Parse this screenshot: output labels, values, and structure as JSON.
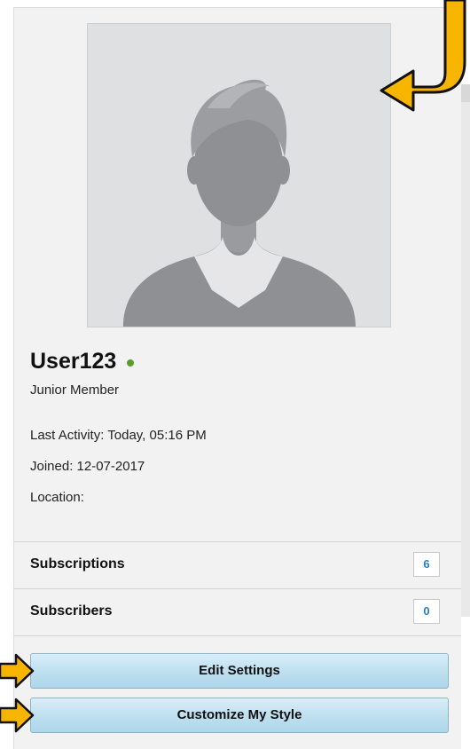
{
  "profile": {
    "username": "User123",
    "online_status": "online",
    "rank": "Junior Member",
    "avatar_alt": "default-avatar-silhouette"
  },
  "details": {
    "last_activity": "Last Activity: Today, 05:16 PM",
    "joined": "Joined: 12-07-2017",
    "location": "Location:"
  },
  "stats": [
    {
      "label": "Subscriptions",
      "count": "6"
    },
    {
      "label": "Subscribers",
      "count": "0"
    }
  ],
  "actions": {
    "edit_settings": "Edit Settings",
    "customize_style": "Customize My Style"
  },
  "colors": {
    "online": "#5a9e2a",
    "count_text": "#2a7fc4",
    "arrow_fill": "#f7b500",
    "arrow_stroke": "#111111",
    "button_top": "#d9eef8",
    "button_bottom": "#aed6ea"
  },
  "icons": [
    "online-status-icon",
    "avatar-silhouette-icon",
    "pointer-arrow-icon"
  ]
}
